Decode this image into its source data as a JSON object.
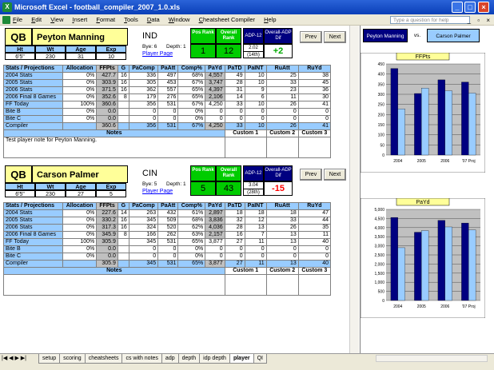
{
  "window": {
    "title": "Microsoft Excel - football_compiler_2007_1.0.xls"
  },
  "menu": [
    "File",
    "Edit",
    "View",
    "Insert",
    "Format",
    "Tools",
    "Data",
    "Window",
    "Cheatsheet Compiler",
    "Help"
  ],
  "help_placeholder": "Type a question for help",
  "players": [
    {
      "pos": "QB",
      "name": "Peyton Manning",
      "team": "IND",
      "ht": "6'5\"",
      "wt": "230",
      "age": "31",
      "exp": "10",
      "bye": "Bye: 6",
      "depth": "Depth: 1",
      "link": "Player Page",
      "pos_rank": "1",
      "overall_rank": "12",
      "adp": "2.02",
      "adp_sub": "(14th)",
      "adp_diff": "+2",
      "adp_diff_color": "#00aa00",
      "note": "Test player note for Peyton Manning.",
      "rows": [
        [
          "2004 Stats",
          "0%",
          "427.7",
          "16",
          "336",
          "497",
          "68%",
          "4,557",
          "49",
          "10",
          "25",
          "38"
        ],
        [
          "2005 Stats",
          "0%",
          "303.9",
          "16",
          "305",
          "453",
          "67%",
          "3,747",
          "28",
          "10",
          "33",
          "45"
        ],
        [
          "2006 Stats",
          "0%",
          "371.5",
          "16",
          "362",
          "557",
          "65%",
          "4,397",
          "31",
          "9",
          "23",
          "36"
        ],
        [
          "2006 Final 8 Games",
          "0%",
          "352.6",
          "8",
          "179",
          "276",
          "65%",
          "2,106",
          "14",
          "6",
          "11",
          "30"
        ],
        [
          "FF Today",
          "100%",
          "360.6",
          "",
          "356",
          "531",
          "67%",
          "4,250",
          "33",
          "10",
          "26",
          "41"
        ],
        [
          "Bite B",
          "0%",
          "0.0",
          "",
          "0",
          "0",
          "0%",
          "0",
          "0",
          "0",
          "0",
          "0"
        ],
        [
          "Bite C",
          "0%",
          "0.0",
          "",
          "0",
          "0",
          "0%",
          "0",
          "0",
          "0",
          "0",
          "0"
        ],
        [
          "Compiler",
          "",
          "360.6",
          "",
          "356",
          "531",
          "67%",
          "4,250",
          "33",
          "10",
          "26",
          "41"
        ]
      ]
    },
    {
      "pos": "QB",
      "name": "Carson Palmer",
      "team": "CIN",
      "ht": "6'5\"",
      "wt": "230",
      "age": "27",
      "exp": "5",
      "bye": "Bye: 5",
      "depth": "Depth: 1",
      "link": "Player Page",
      "pos_rank": "5",
      "overall_rank": "43",
      "adp": "3.04",
      "adp_sub": "(28th)",
      "adp_diff": "-15",
      "adp_diff_color": "#ff0000",
      "note": "",
      "rows": [
        [
          "2004 Stats",
          "0%",
          "227.6",
          "14",
          "263",
          "432",
          "61%",
          "2,897",
          "18",
          "18",
          "18",
          "47"
        ],
        [
          "2005 Stats",
          "0%",
          "330.2",
          "16",
          "345",
          "509",
          "68%",
          "3,836",
          "32",
          "12",
          "33",
          "44"
        ],
        [
          "2006 Stats",
          "0%",
          "317.3",
          "16",
          "324",
          "520",
          "62%",
          "4,036",
          "28",
          "13",
          "26",
          "35"
        ],
        [
          "2006 Final 8 Games",
          "0%",
          "345.9",
          "8",
          "166",
          "262",
          "63%",
          "2,157",
          "16",
          "7",
          "13",
          "11"
        ],
        [
          "FF Today",
          "100%",
          "305.9",
          "",
          "345",
          "531",
          "65%",
          "3,877",
          "27",
          "11",
          "13",
          "40"
        ],
        [
          "Bite B",
          "0%",
          "0.0",
          "",
          "0",
          "0",
          "0%",
          "0",
          "0",
          "0",
          "0",
          "0"
        ],
        [
          "Bite C",
          "0%",
          "0.0",
          "",
          "0",
          "0",
          "0%",
          "0",
          "0",
          "0",
          "0",
          "0"
        ],
        [
          "Compiler",
          "",
          "305.9",
          "",
          "345",
          "531",
          "65%",
          "3,877",
          "27",
          "11",
          "13",
          "40"
        ]
      ]
    }
  ],
  "labels": {
    "ht": "Ht",
    "wt": "Wt",
    "age": "Age",
    "exp": "Exp",
    "pos_rank": "Pos Rank",
    "overall_rank": "Overall Rank",
    "adp": "ADP-12",
    "adp_diff": "Overall-ADP Dif",
    "prev": "Prev",
    "next": "Next",
    "notes": "Notes",
    "custom1": "Custom 1",
    "custom2": "Custom 2",
    "custom3": "Custom 3",
    "vs": "vs."
  },
  "table_headers": [
    "Stats / Projections",
    "Allocation",
    "FFPts",
    "G",
    "PaComp",
    "PaAtt",
    "Comp%",
    "PaYd",
    "PaTD",
    "PaINT",
    "RuAtt",
    "RuYd"
  ],
  "compare": {
    "player1": "Peyton Manning",
    "player2": "Carson Palmer"
  },
  "chart_data": [
    {
      "type": "bar",
      "title": "FFPts",
      "categories": [
        "2004",
        "2005",
        "2006",
        "'07 Proj"
      ],
      "ylim": [
        0,
        450
      ],
      "yticks": [
        0,
        50,
        100,
        150,
        200,
        250,
        300,
        350,
        400,
        450
      ],
      "series": [
        {
          "name": "Peyton Manning",
          "color": "#000080",
          "values": [
            427.7,
            303.9,
            371.5,
            360.6
          ]
        },
        {
          "name": "Carson Palmer",
          "color": "#99ccff",
          "values": [
            227.6,
            330.2,
            317.3,
            305.9
          ]
        }
      ]
    },
    {
      "type": "bar",
      "title": "PaYd",
      "categories": [
        "2004",
        "2005",
        "2006",
        "'07 Proj"
      ],
      "ylim": [
        0,
        5000
      ],
      "yticks": [
        0,
        500,
        1000,
        1500,
        2000,
        2500,
        3000,
        3500,
        4000,
        4500,
        5000
      ],
      "series": [
        {
          "name": "Peyton Manning",
          "color": "#000080",
          "values": [
            4557,
            3747,
            4397,
            4250
          ]
        },
        {
          "name": "Carson Palmer",
          "color": "#99ccff",
          "values": [
            2897,
            3836,
            4036,
            3877
          ]
        }
      ]
    }
  ],
  "sheet_tabs": [
    "setup",
    "scoring",
    "cheatsheets",
    "cs with notes",
    "adp",
    "depth",
    "idp depth",
    "player",
    "QI"
  ],
  "active_tab": "player"
}
